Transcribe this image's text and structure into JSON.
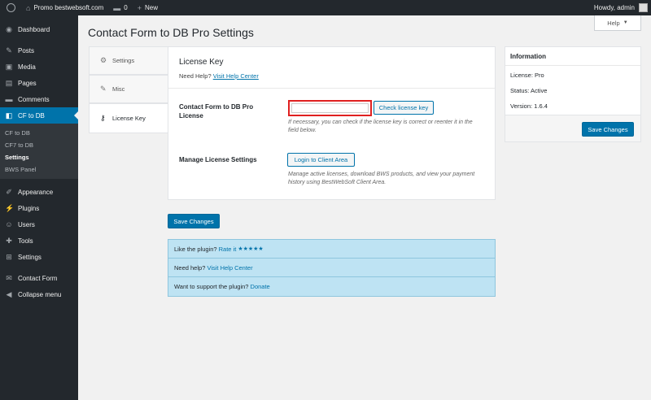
{
  "adminbar": {
    "site_name": "Promo bestwebsoft.com",
    "comments_count": "0",
    "new_label": "New",
    "howdy": "Howdy, admin"
  },
  "sidebar": {
    "items": [
      {
        "label": "Dashboard",
        "icon": "dashboard-icon",
        "glyph": "◉"
      },
      {
        "label": "Posts",
        "icon": "pin-icon",
        "glyph": "✎"
      },
      {
        "label": "Media",
        "icon": "media-icon",
        "glyph": "▣"
      },
      {
        "label": "Pages",
        "icon": "pages-icon",
        "glyph": "▤"
      },
      {
        "label": "Comments",
        "icon": "comment-icon",
        "glyph": "▬"
      },
      {
        "label": "CF to DB",
        "icon": "cf-to-db-icon",
        "glyph": "◧"
      }
    ],
    "submenu": [
      "CF to DB",
      "CF7 to DB",
      "Settings",
      "BWS Panel"
    ],
    "items2": [
      {
        "label": "Appearance",
        "icon": "brush-icon",
        "glyph": "✐"
      },
      {
        "label": "Plugins",
        "icon": "plugin-icon",
        "glyph": "⚡"
      },
      {
        "label": "Users",
        "icon": "users-icon",
        "glyph": "☺"
      },
      {
        "label": "Tools",
        "icon": "wrench-icon",
        "glyph": "✚"
      },
      {
        "label": "Settings",
        "icon": "settings-icon",
        "glyph": "⊞"
      },
      {
        "label": "Contact Form",
        "icon": "mail-icon",
        "glyph": "✉"
      },
      {
        "label": "Collapse menu",
        "icon": "collapse-icon",
        "glyph": "◀"
      }
    ]
  },
  "help_tab": "Help",
  "page_title": "Contact Form to DB Pro Settings",
  "tabs": [
    {
      "label": "Settings",
      "icon": "gear-icon",
      "glyph": "⚙"
    },
    {
      "label": "Misc",
      "icon": "wrench-icon",
      "glyph": "🔧"
    },
    {
      "label": "License Key",
      "icon": "key-icon",
      "glyph": "⚷"
    }
  ],
  "panel": {
    "heading": "License Key",
    "need_help_prefix": "Need Help?",
    "need_help_link": "Visit Help Center",
    "license_label": "Contact Form to DB Pro License",
    "license_value": "",
    "check_button": "Check license key",
    "license_desc": "If necessary, you can check if the license key is correct or reenter it in the field below.",
    "manage_label": "Manage License Settings",
    "login_button": "Login to Client Area",
    "manage_desc": "Manage active licenses, download BWS products, and view your payment history using BestWebSoft Client Area."
  },
  "save_button": "Save Changes",
  "info": {
    "title": "Information",
    "license": "License: Pro",
    "status": "Status: Active",
    "version": "Version: 1.6.4",
    "save_button": "Save Changes"
  },
  "promo": {
    "rate_prefix": "Like the plugin?",
    "rate_link": "Rate it",
    "stars": "★★★★★",
    "help_prefix": "Need help?",
    "help_link": "Visit Help Center",
    "donate_prefix": "Want to support the plugin?",
    "donate_link": "Donate"
  },
  "colors": {
    "admin_dark": "#23282d",
    "accent": "#0073aa",
    "promo_bg": "#bee3f3",
    "highlight_red": "#e02020"
  }
}
